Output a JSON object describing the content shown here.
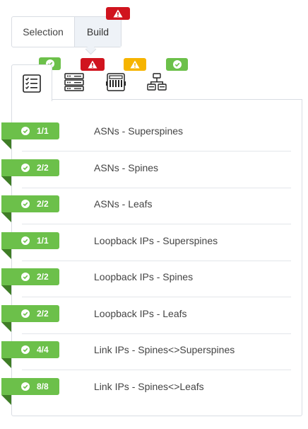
{
  "toggle": {
    "selection_label": "Selection",
    "build_label": "Build",
    "active": "Build"
  },
  "colors": {
    "ok": "#6cc04a",
    "error": "#d0141e",
    "warning": "#f6b400",
    "fold": "#3f7d26"
  },
  "tabs": [
    {
      "icon": "checklist-icon",
      "status": "ok"
    },
    {
      "icon": "server-stack-icon",
      "status": "error"
    },
    {
      "icon": "switch-chassis-icon",
      "status": "warning"
    },
    {
      "icon": "network-topology-icon",
      "status": "ok"
    }
  ],
  "rows": [
    {
      "count": "1/1",
      "label": "ASNs - Superspines"
    },
    {
      "count": "2/2",
      "label": "ASNs - Spines"
    },
    {
      "count": "2/2",
      "label": "ASNs - Leafs"
    },
    {
      "count": "1/1",
      "label": "Loopback IPs - Superspines"
    },
    {
      "count": "2/2",
      "label": "Loopback IPs - Spines"
    },
    {
      "count": "2/2",
      "label": "Loopback IPs - Leafs"
    },
    {
      "count": "4/4",
      "label": "Link IPs - Spines<>Superspines"
    },
    {
      "count": "8/8",
      "label": "Link IPs - Spines<>Leafs"
    }
  ]
}
